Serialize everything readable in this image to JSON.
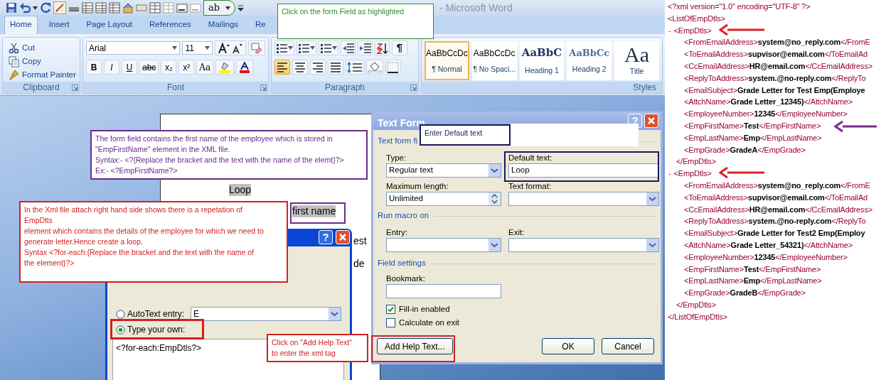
{
  "window": {
    "title": "- Microsoft Word",
    "form_field_button": "ab"
  },
  "tabs": [
    {
      "label": "Home",
      "selected": true
    },
    {
      "label": "Insert",
      "selected": false
    },
    {
      "label": "Page Layout",
      "selected": false
    },
    {
      "label": "References",
      "selected": false
    },
    {
      "label": "Mailings",
      "selected": false
    },
    {
      "label": "Re",
      "selected": false
    }
  ],
  "clipboard": {
    "title": "Clipboard",
    "commands": [
      "Cut",
      "Copy",
      "Format Painter"
    ]
  },
  "font": {
    "title": "Font",
    "family": "Arial",
    "size": "11",
    "buttons": [
      "B",
      "I",
      "U",
      "abc",
      "x₂",
      "x²",
      "Aa"
    ]
  },
  "paragraph": {
    "title": "Paragraph",
    "pilcrow": "¶",
    "alignments": [
      {
        "selected": true
      },
      {
        "selected": false
      },
      {
        "selected": false
      },
      {
        "selected": false
      }
    ]
  },
  "styles": {
    "title": "Styles",
    "items": [
      {
        "preview": "AaBbCcDc",
        "label": "¶ Normal",
        "kind": "body",
        "selected": true
      },
      {
        "preview": "AaBbCcDc",
        "label": "¶ No Spaci...",
        "kind": "body",
        "selected": false
      },
      {
        "preview": "AaBbC",
        "label": "Heading 1",
        "kind": "heading",
        "selected": false
      },
      {
        "preview": "AaBbCc",
        "label": "Heading 2",
        "kind": "subheading",
        "selected": false
      },
      {
        "preview": "Aa",
        "label": "Title",
        "kind": "title",
        "selected": false
      }
    ]
  },
  "document": {
    "lines": [
      "Loop",
      "first name",
      "est",
      "de"
    ]
  },
  "autotext_dialog": {
    "help": "?",
    "options": [
      {
        "label": "AutoText entry:",
        "selected": false
      },
      {
        "label": "Type your own:",
        "selected": true
      }
    ],
    "autotext_value": "E",
    "own_text": "<?for-each:EmpDtls?>"
  },
  "form_field_dialog": {
    "title": "Text Form",
    "help": "?",
    "section_text_form": "Text form fi",
    "type_label": "Type:",
    "type_value": "Regular text",
    "default_label": "Default text:",
    "default_value": "Loop",
    "maxlen_label": "Maximum length:",
    "maxlen_value": "Unlimited",
    "format_label": "Text format:",
    "section_macro": "Run macro on",
    "entry_label": "Entry:",
    "exit_label": "Exit:",
    "section_field": "Field settings",
    "bookmark_label": "Bookmark:",
    "checkboxes": [
      {
        "label": "Fill-in enabled",
        "checked": true
      },
      {
        "label": "Calculate on exit",
        "checked": false
      }
    ],
    "buttons": [
      "Add Help Text...",
      "OK",
      "Cancel"
    ]
  },
  "callouts": [
    {
      "color": "#2e8b2e",
      "lines": [
        "Click on the form Field as highlighted"
      ]
    },
    {
      "color": "#6a2a8a",
      "lines": [
        "The form field contains the first name of the employee which is stored in",
        "\"EmpFirstName\" element in the XML file.",
        "Syntax:- <?{Replace the bracket and the text with the name of the elemt}?>",
        "Ex:- <?EmpFirstName?>"
      ]
    },
    {
      "color": "#d42020",
      "lines": [
        "In the Xml file attach right hand side shows there is a repetation of",
        "EmpDtls",
        "element which contains the details of the employee for which we need to",
        "generate letter.Hence create a loop.",
        "Syntax <?for-each:{Replace the bracket and the text with the name of",
        "the element}?>"
      ]
    },
    {
      "color": "#d42020",
      "lines": [
        "Click on \"Add Help Text\"",
        "to enter the xml tag"
      ]
    },
    {
      "color": "#1a1a5e",
      "lines": [
        "Enter Default text"
      ]
    }
  ],
  "xml": {
    "declaration": "<?xml version=\"1.0\" encoding=\"UTF-8\" ?>",
    "root": {
      "text": "<ListOfEmpDtls>",
      "end": "</ListOfEmpDtls>",
      "children": [
        {
          "toggle": "-",
          "text": "<EmpDtls>",
          "end": "</EmpDtls>",
          "children": [
            {
              "open": "<FromEmailAddress>",
              "value": "system@no_reply.com",
              "close": "</FromE"
            },
            {
              "open": "<ToEmailAddress>",
              "value": "supvisor@email.com",
              "close": "</ToEmailAd"
            },
            {
              "open": "<CcEmailAddress>",
              "value": "HR@email.com",
              "close": "</CcEmailAddress>"
            },
            {
              "open": "<ReplyToAddress>",
              "value": "system.@no-reply.com",
              "close": "</ReplyTo"
            },
            {
              "open": "<EmailSubject>",
              "value": "Grade Letter for Test Emp(Employe"
            },
            {
              "open": "<AttchName>",
              "value": "Grade Letter_12345)",
              "close": "</AttchName>"
            },
            {
              "open": "<EmployeeNumber>",
              "value": "12345",
              "close": "</EmployeeNumber>"
            },
            {
              "open": "<EmpFirstName>",
              "value": "Test",
              "close": "</EmpFirstName>"
            },
            {
              "open": "<EmpLastName>",
              "value": "Emp",
              "close": "</EmpLastName>"
            },
            {
              "open": "<EmpGrade>",
              "value": "GradeA",
              "close": "</EmpGrade>"
            }
          ]
        },
        {
          "toggle": "-",
          "text": "<EmpDtls>",
          "end": "</EmpDtls>",
          "children": [
            {
              "open": "<FromEmailAddress>",
              "value": "system@no_reply.com",
              "close": "</FromE"
            },
            {
              "open": "<ToEmailAddress>",
              "value": "supvisor@email.com",
              "close": "</ToEmailAd"
            },
            {
              "open": "<CcEmailAddress>",
              "value": "HR@email.com",
              "close": "</CcEmailAddress>"
            },
            {
              "open": "<ReplyToAddress>",
              "value": "system.@no-reply.com",
              "close": "</ReplyTo"
            },
            {
              "open": "<EmailSubject>",
              "value": "Grade Letter for Test2 Emp(Employ"
            },
            {
              "open": "<AttchName>",
              "value": "Grade Letter_54321)",
              "close": "</AttchName>"
            },
            {
              "open": "<EmployeeNumber>",
              "value": "12345",
              "close": "</EmployeeNumber>"
            },
            {
              "open": "<EmpFirstName>",
              "value": "Test",
              "close": "</EmpFirstName>"
            },
            {
              "open": "<EmpLastName>",
              "value": "Emp",
              "close": "</EmpLastName>"
            },
            {
              "open": "<EmpGrade>",
              "value": "GradeB",
              "close": "</EmpGrade>"
            }
          ]
        }
      ]
    }
  }
}
